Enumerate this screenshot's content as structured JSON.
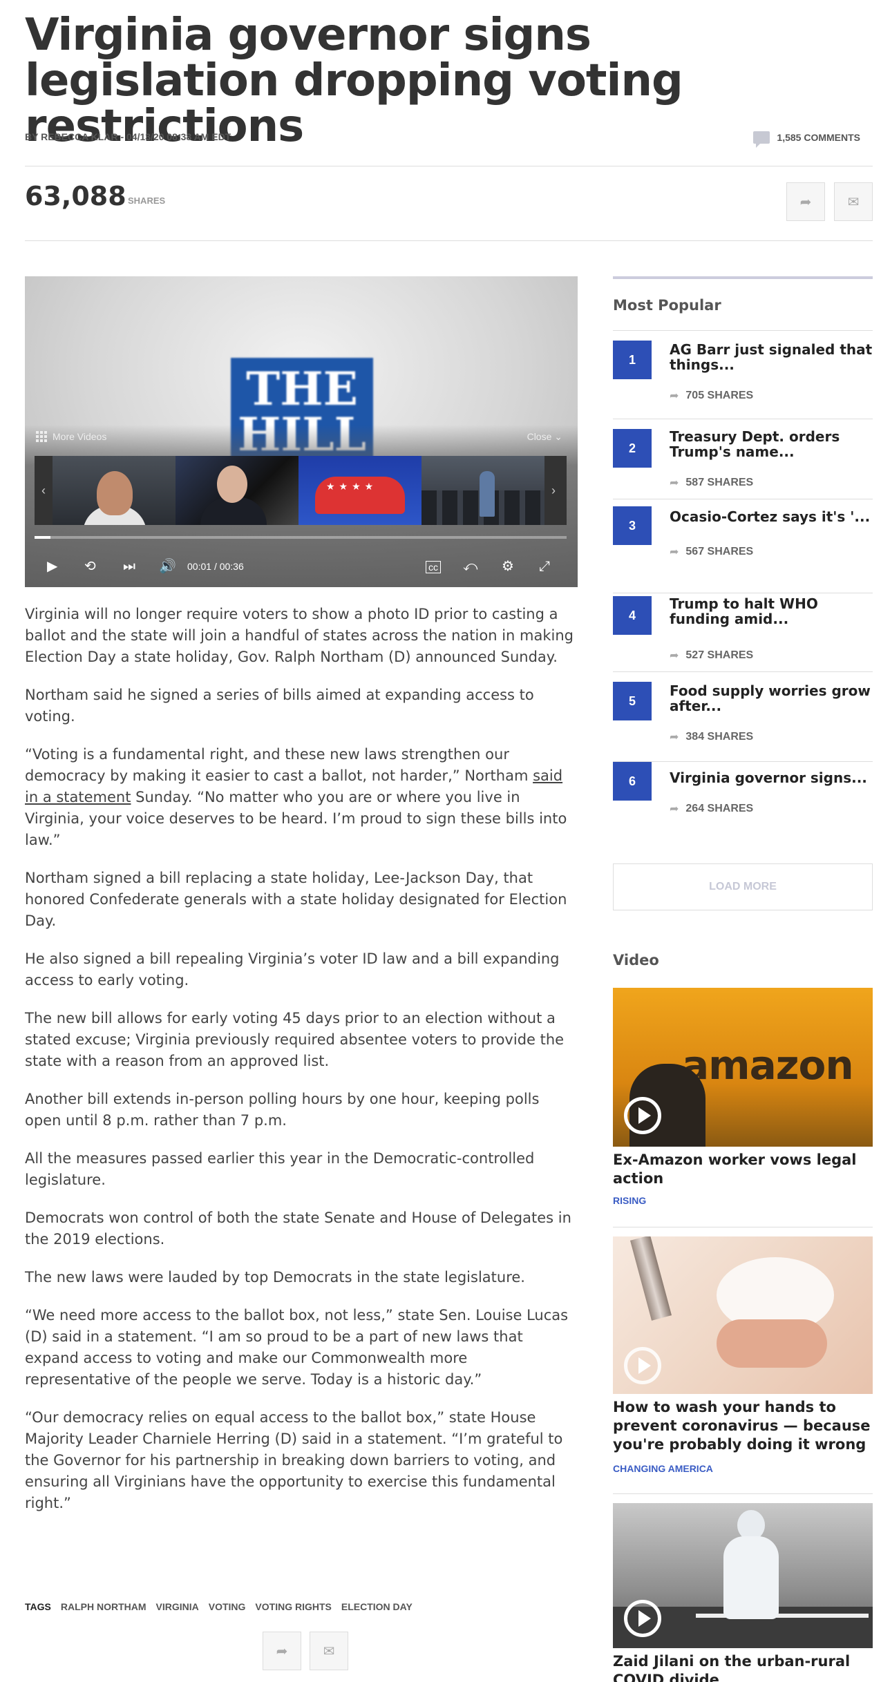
{
  "article": {
    "headline": "Virginia governor signs legislation dropping voting restrictions",
    "byline": "BY REBECCA KLAR - 04/13/20 08:38 AM EDT",
    "comments": "1,585 COMMENTS",
    "shares_count": "63,088",
    "shares_label": "SHARES",
    "paragraphs": [
      "Virginia will no longer require voters to show a photo ID prior to casting a ballot and the state will join a handful of states across the nation in making Election Day a state holiday, Gov. Ralph Northam (D) announced Sunday.",
      "Northam said he signed a series of bills aimed at expanding access to voting.",
      "",
      "Northam signed a bill replacing a state holiday, Lee-Jackson Day, that honored Confederate generals with a state holiday designated for Election Day.",
      "He also signed a bill repealing Virginia’s voter ID law and a bill expanding access to early voting.",
      "The new bill allows for early voting 45 days prior to an election without a stated excuse; Virginia previously required absentee voters to provide the state with a reason from an approved list.",
      "Another bill extends in-person polling hours by one hour, keeping polls open until 8 p.m. rather than 7 p.m.",
      "All the measures passed earlier this year in the Democratic-controlled legislature.",
      "Democrats won control of both the state Senate and House of Delegates in the 2019 elections.",
      "The new laws were lauded by top Democrats in the state legislature.",
      "“We need more access to the ballot box, not less,” state Sen. Louise Lucas (D) said in a statement. “I am so proud to be a part of new laws that expand access to voting and make our Commonwealth more representative of the people we serve. Today is a historic day.”",
      "“Our democracy relies on equal access to the ballot box,” state House Majority Leader Charniele Herring (D) said in a statement. “I’m grateful to the Governor for his partnership in breaking down barriers to voting, and ensuring all Virginians have the opportunity to exercise this fundamental right.”"
    ],
    "quote_p3": {
      "before": "“Voting is a fundamental right, and these new laws strengthen our democracy by making it easier to cast a ballot, not harder,” Northam ",
      "link": "said in a statement",
      "after": " Sunday. “No matter who you are or where you live in Virginia, your voice deserves to be heard. I’m proud to sign these bills into law.”"
    },
    "tags_label": "TAGS",
    "tags": [
      "RALPH NORTHAM",
      "VIRGINIA",
      "VOTING",
      "VOTING RIGHTS",
      "ELECTION DAY"
    ]
  },
  "player": {
    "logo_text": "THE HILL",
    "more_videos": "More Videos",
    "close": "Close",
    "time_current": "00:01",
    "time_separator": "/",
    "time_total": "00:36",
    "progress": 0.03
  },
  "sidebar": {
    "most_popular_title": "Most Popular",
    "items": [
      {
        "rank": "1",
        "title": "AG Barr just signaled that things...",
        "shares": "705 SHARES"
      },
      {
        "rank": "2",
        "title": "Treasury Dept. orders Trump's name...",
        "shares": "587 SHARES"
      },
      {
        "rank": "3",
        "title": "Ocasio-Cortez says it's '...",
        "shares": "567 SHARES"
      },
      {
        "rank": "4",
        "title": "Trump to halt WHO funding amid...",
        "shares": "527 SHARES"
      },
      {
        "rank": "5",
        "title": "Food supply worries grow after...",
        "shares": "384 SHARES"
      },
      {
        "rank": "6",
        "title": "Virginia governor signs...",
        "shares": "264 SHARES"
      }
    ],
    "load_more": "LOAD MORE",
    "video_title": "Video",
    "videos": [
      {
        "image_text": "amazon",
        "caption": "Ex-Amazon worker vows legal action",
        "tag": "RISING"
      },
      {
        "caption": "How to wash your hands to prevent coronavirus — because you're probably doing it wrong",
        "tag": "CHANGING AMERICA"
      },
      {
        "caption": "Zaid Jilani on the urban-rural COVID divide"
      }
    ]
  },
  "colors": {
    "accent": "#2d4fb6",
    "tag_link": "#3a5cc4"
  }
}
